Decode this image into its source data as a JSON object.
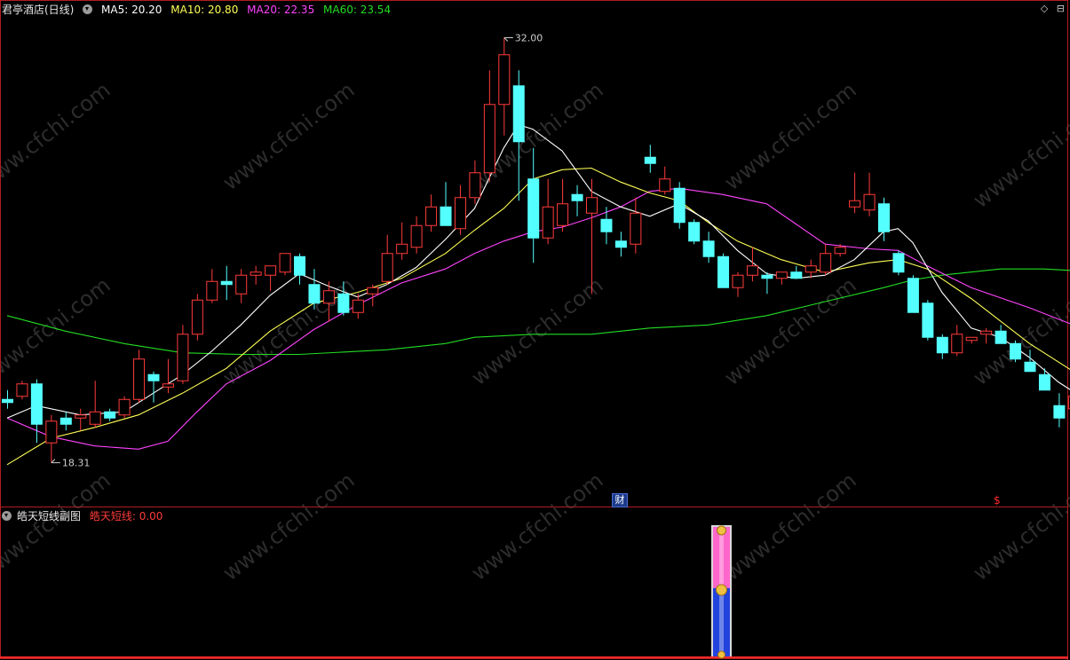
{
  "main_header": {
    "stock_name": "君亭酒店(日线)",
    "ma5": "MA5: 20.20",
    "ma10": "MA10: 20.80",
    "ma20": "MA20: 22.35",
    "ma60": "MA60: 23.54"
  },
  "sub_header": {
    "indicator_name": "皓天短线副图",
    "indicator_value": "皓天短线: 0.00"
  },
  "high_label": "32.00",
  "low_label": "18.31",
  "fin_badge": "财",
  "dollar_mark": "$",
  "watermark": "www.cfchi.com",
  "colors": {
    "up": "#ff3b3b",
    "down": "#54ffff",
    "ma5": "#ffffff",
    "ma10": "#ffff55",
    "ma20": "#ff44ff",
    "ma60": "#22dd22",
    "border": "#b01e1e",
    "gauge_top": "#ff66cc",
    "gauge_bottom": "#2244dd"
  },
  "chart_data": {
    "type": "candlestick",
    "y_range": [
      17.5,
      32.5
    ],
    "candles": [
      {
        "o": 20.35,
        "h": 20.65,
        "l": 20.05,
        "c": 20.25
      },
      {
        "o": 20.45,
        "h": 20.95,
        "l": 20.35,
        "c": 20.85
      },
      {
        "o": 20.85,
        "h": 21.0,
        "l": 18.95,
        "c": 19.55
      },
      {
        "o": 18.95,
        "h": 19.85,
        "l": 18.31,
        "c": 19.65
      },
      {
        "o": 19.75,
        "h": 19.95,
        "l": 19.35,
        "c": 19.55
      },
      {
        "o": 19.75,
        "h": 20.05,
        "l": 19.35,
        "c": 19.85
      },
      {
        "o": 19.55,
        "h": 20.95,
        "l": 19.45,
        "c": 19.95
      },
      {
        "o": 19.95,
        "h": 20.05,
        "l": 19.65,
        "c": 19.75
      },
      {
        "o": 19.85,
        "h": 20.45,
        "l": 19.75,
        "c": 20.35
      },
      {
        "o": 20.35,
        "h": 21.95,
        "l": 20.25,
        "c": 21.65
      },
      {
        "o": 21.15,
        "h": 21.25,
        "l": 20.25,
        "c": 20.95
      },
      {
        "o": 20.75,
        "h": 21.65,
        "l": 20.55,
        "c": 20.85
      },
      {
        "o": 20.95,
        "h": 22.75,
        "l": 20.85,
        "c": 22.45
      },
      {
        "o": 22.45,
        "h": 23.75,
        "l": 22.25,
        "c": 23.55
      },
      {
        "o": 23.55,
        "h": 24.55,
        "l": 23.45,
        "c": 24.15
      },
      {
        "o": 24.15,
        "h": 24.65,
        "l": 23.55,
        "c": 24.05
      },
      {
        "o": 23.75,
        "h": 24.55,
        "l": 23.45,
        "c": 24.35
      },
      {
        "o": 24.35,
        "h": 24.65,
        "l": 24.05,
        "c": 24.45
      },
      {
        "o": 24.35,
        "h": 24.55,
        "l": 23.85,
        "c": 24.65
      },
      {
        "o": 24.45,
        "h": 24.95,
        "l": 24.35,
        "c": 25.05
      },
      {
        "o": 24.95,
        "h": 25.05,
        "l": 24.05,
        "c": 24.35
      },
      {
        "o": 24.05,
        "h": 24.55,
        "l": 23.25,
        "c": 23.45
      },
      {
        "o": 23.45,
        "h": 24.15,
        "l": 22.85,
        "c": 23.85
      },
      {
        "o": 23.75,
        "h": 24.15,
        "l": 23.05,
        "c": 23.15
      },
      {
        "o": 23.15,
        "h": 23.75,
        "l": 22.95,
        "c": 23.55
      },
      {
        "o": 23.75,
        "h": 24.05,
        "l": 23.35,
        "c": 23.95
      },
      {
        "o": 24.15,
        "h": 25.65,
        "l": 24.05,
        "c": 25.05
      },
      {
        "o": 25.05,
        "h": 26.05,
        "l": 24.85,
        "c": 25.35
      },
      {
        "o": 25.25,
        "h": 26.25,
        "l": 25.05,
        "c": 25.95
      },
      {
        "o": 25.95,
        "h": 26.95,
        "l": 25.75,
        "c": 26.55
      },
      {
        "o": 26.55,
        "h": 27.35,
        "l": 26.15,
        "c": 25.95
      },
      {
        "o": 25.85,
        "h": 27.25,
        "l": 25.65,
        "c": 26.85
      },
      {
        "o": 26.85,
        "h": 28.05,
        "l": 26.65,
        "c": 27.65
      },
      {
        "o": 27.65,
        "h": 30.95,
        "l": 27.35,
        "c": 29.85
      },
      {
        "o": 29.85,
        "h": 32.0,
        "l": 28.85,
        "c": 31.45
      },
      {
        "o": 30.45,
        "h": 30.95,
        "l": 26.75,
        "c": 28.65
      },
      {
        "o": 27.45,
        "h": 28.45,
        "l": 24.75,
        "c": 25.55
      },
      {
        "o": 25.55,
        "h": 27.45,
        "l": 25.35,
        "c": 26.55
      },
      {
        "o": 25.95,
        "h": 27.45,
        "l": 25.75,
        "c": 26.65
      },
      {
        "o": 26.95,
        "h": 27.25,
        "l": 26.25,
        "c": 26.75
      },
      {
        "o": 26.35,
        "h": 27.45,
        "l": 23.75,
        "c": 26.85
      },
      {
        "o": 26.15,
        "h": 26.55,
        "l": 25.35,
        "c": 25.75
      },
      {
        "o": 25.45,
        "h": 25.75,
        "l": 24.95,
        "c": 25.25
      },
      {
        "o": 25.35,
        "h": 26.85,
        "l": 25.05,
        "c": 26.35
      },
      {
        "o": 28.15,
        "h": 28.55,
        "l": 27.65,
        "c": 27.95
      },
      {
        "o": 27.05,
        "h": 27.85,
        "l": 26.95,
        "c": 27.45
      },
      {
        "o": 27.15,
        "h": 27.35,
        "l": 25.85,
        "c": 26.05
      },
      {
        "o": 26.05,
        "h": 26.15,
        "l": 25.35,
        "c": 25.45
      },
      {
        "o": 25.45,
        "h": 25.75,
        "l": 24.75,
        "c": 24.95
      },
      {
        "o": 24.95,
        "h": 25.05,
        "l": 23.95,
        "c": 23.95
      },
      {
        "o": 23.95,
        "h": 24.45,
        "l": 23.65,
        "c": 24.35
      },
      {
        "o": 24.35,
        "h": 25.25,
        "l": 24.15,
        "c": 24.65
      },
      {
        "o": 24.35,
        "h": 24.45,
        "l": 23.75,
        "c": 24.25
      },
      {
        "o": 24.25,
        "h": 24.45,
        "l": 24.05,
        "c": 24.45
      },
      {
        "o": 24.45,
        "h": 24.65,
        "l": 24.25,
        "c": 24.25
      },
      {
        "o": 24.45,
        "h": 24.85,
        "l": 24.25,
        "c": 24.65
      },
      {
        "o": 24.45,
        "h": 25.35,
        "l": 24.35,
        "c": 25.05
      },
      {
        "o": 25.05,
        "h": 25.35,
        "l": 24.95,
        "c": 25.25
      },
      {
        "o": 26.55,
        "h": 27.65,
        "l": 26.35,
        "c": 26.75
      },
      {
        "o": 26.45,
        "h": 27.65,
        "l": 26.25,
        "c": 26.95
      },
      {
        "o": 26.65,
        "h": 26.85,
        "l": 25.45,
        "c": 25.75
      },
      {
        "o": 25.05,
        "h": 25.15,
        "l": 24.35,
        "c": 24.45
      },
      {
        "o": 24.25,
        "h": 24.35,
        "l": 23.15,
        "c": 23.15
      },
      {
        "o": 23.45,
        "h": 23.55,
        "l": 22.25,
        "c": 22.35
      },
      {
        "o": 22.35,
        "h": 22.45,
        "l": 21.65,
        "c": 21.85
      },
      {
        "o": 21.85,
        "h": 22.75,
        "l": 21.75,
        "c": 22.45
      },
      {
        "o": 22.25,
        "h": 22.35,
        "l": 22.15,
        "c": 22.35
      },
      {
        "o": 22.45,
        "h": 22.65,
        "l": 22.15,
        "c": 22.55
      },
      {
        "o": 22.55,
        "h": 22.75,
        "l": 22.15,
        "c": 22.15
      },
      {
        "o": 22.15,
        "h": 22.25,
        "l": 21.55,
        "c": 21.65
      },
      {
        "o": 21.55,
        "h": 21.95,
        "l": 21.25,
        "c": 21.25
      },
      {
        "o": 21.15,
        "h": 21.35,
        "l": 20.65,
        "c": 20.65
      },
      {
        "o": 20.15,
        "h": 20.55,
        "l": 19.45,
        "c": 19.75
      },
      {
        "o": 20.05,
        "h": 20.45,
        "l": 19.95,
        "c": 20.45
      }
    ],
    "ma5": [
      [
        0,
        19.75
      ],
      [
        2,
        20.15
      ],
      [
        5,
        19.85
      ],
      [
        8,
        19.95
      ],
      [
        10,
        20.55
      ],
      [
        12,
        21.15
      ],
      [
        14,
        21.9
      ],
      [
        16,
        22.75
      ],
      [
        18,
        23.7
      ],
      [
        20,
        24.4
      ],
      [
        22,
        24.0
      ],
      [
        24,
        23.65
      ],
      [
        26,
        24.05
      ],
      [
        28,
        24.6
      ],
      [
        30,
        25.5
      ],
      [
        32,
        26.5
      ],
      [
        34,
        28.45
      ],
      [
        35,
        29.2
      ],
      [
        36,
        29.05
      ],
      [
        38,
        28.35
      ],
      [
        40,
        27.05
      ],
      [
        42,
        26.55
      ],
      [
        44,
        26.25
      ],
      [
        46,
        26.65
      ],
      [
        48,
        26.1
      ],
      [
        50,
        25.15
      ],
      [
        52,
        24.4
      ],
      [
        54,
        24.25
      ],
      [
        56,
        24.35
      ],
      [
        58,
        24.85
      ],
      [
        60,
        25.75
      ],
      [
        61,
        25.85
      ],
      [
        62,
        25.4
      ],
      [
        64,
        23.8
      ],
      [
        66,
        22.65
      ],
      [
        68,
        22.35
      ],
      [
        70,
        21.7
      ],
      [
        72,
        20.9
      ],
      [
        73,
        20.6
      ]
    ],
    "ma10": [
      [
        0,
        18.25
      ],
      [
        3,
        19.1
      ],
      [
        6,
        19.45
      ],
      [
        9,
        19.85
      ],
      [
        12,
        20.55
      ],
      [
        15,
        21.35
      ],
      [
        18,
        22.55
      ],
      [
        21,
        23.45
      ],
      [
        24,
        23.8
      ],
      [
        27,
        24.25
      ],
      [
        30,
        25.05
      ],
      [
        32,
        25.8
      ],
      [
        34,
        26.5
      ],
      [
        36,
        27.45
      ],
      [
        38,
        27.75
      ],
      [
        40,
        27.8
      ],
      [
        42,
        27.35
      ],
      [
        44,
        27.0
      ],
      [
        46,
        26.75
      ],
      [
        48,
        26.05
      ],
      [
        50,
        25.45
      ],
      [
        53,
        24.85
      ],
      [
        56,
        24.45
      ],
      [
        59,
        24.75
      ],
      [
        61,
        24.85
      ],
      [
        63,
        24.55
      ],
      [
        66,
        23.6
      ],
      [
        70,
        22.15
      ],
      [
        73,
        21.25
      ]
    ],
    "ma20": [
      [
        0,
        19.75
      ],
      [
        3,
        19.15
      ],
      [
        6,
        18.85
      ],
      [
        9,
        18.75
      ],
      [
        11,
        19.0
      ],
      [
        13,
        19.95
      ],
      [
        15,
        20.85
      ],
      [
        18,
        21.6
      ],
      [
        21,
        22.6
      ],
      [
        24,
        23.4
      ],
      [
        27,
        24.1
      ],
      [
        30,
        24.55
      ],
      [
        32,
        25.05
      ],
      [
        34,
        25.45
      ],
      [
        36,
        25.75
      ],
      [
        38,
        25.9
      ],
      [
        40,
        26.2
      ],
      [
        42,
        26.55
      ],
      [
        44,
        27.05
      ],
      [
        46,
        27.15
      ],
      [
        49,
        26.95
      ],
      [
        52,
        26.65
      ],
      [
        54,
        26.0
      ],
      [
        56,
        25.35
      ],
      [
        59,
        25.2
      ],
      [
        61,
        25.15
      ],
      [
        63,
        24.65
      ],
      [
        66,
        23.95
      ],
      [
        70,
        23.3
      ],
      [
        73,
        22.75
      ]
    ],
    "ma60": [
      [
        0,
        23.05
      ],
      [
        4,
        22.55
      ],
      [
        8,
        22.15
      ],
      [
        12,
        21.85
      ],
      [
        16,
        21.8
      ],
      [
        20,
        21.8
      ],
      [
        26,
        21.95
      ],
      [
        30,
        22.15
      ],
      [
        32,
        22.35
      ],
      [
        36,
        22.45
      ],
      [
        40,
        22.45
      ],
      [
        44,
        22.65
      ],
      [
        48,
        22.75
      ],
      [
        52,
        23.05
      ],
      [
        56,
        23.5
      ],
      [
        60,
        23.95
      ],
      [
        62,
        24.2
      ],
      [
        64,
        24.35
      ],
      [
        68,
        24.55
      ],
      [
        71,
        24.55
      ],
      [
        73,
        24.5
      ]
    ],
    "indicator": {
      "value": 0.0,
      "gauge_fraction": 0.5
    }
  }
}
